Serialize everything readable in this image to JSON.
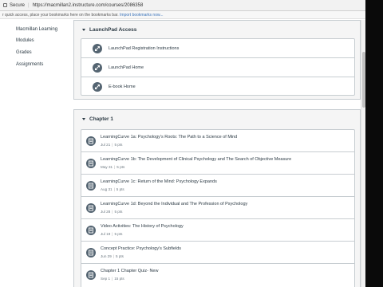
{
  "browser": {
    "secure_label": "Secure",
    "url": "https://macmillan2.instructure.com/courses/2086358",
    "bookmarks_prompt": "r quick access, place your bookmarks here on the bookmarks bar.",
    "import_link": "Import bookmarks now..."
  },
  "nav": {
    "items": [
      {
        "label": "Macmillan Learning"
      },
      {
        "label": "Modules"
      },
      {
        "label": "Grades"
      },
      {
        "label": "Assignments"
      }
    ]
  },
  "modules": [
    {
      "title": "LaunchPad Access",
      "items": [
        {
          "title": "LaunchPad Registration Instructions",
          "icon": "link-icon"
        },
        {
          "title": "LaunchPad Home",
          "icon": "link-icon"
        },
        {
          "title": "E-book Home",
          "icon": "link-icon"
        }
      ]
    },
    {
      "title": "Chapter 1",
      "items": [
        {
          "title": "LearningCurve 1a: Psychology's Roots: The Path to a Science of Mind",
          "date": "Jul 21",
          "points": "5 pts",
          "icon": "assignment-icon"
        },
        {
          "title": "LearningCurve 1b: The Development of Clinical Psychology and The Search of Objective Measure",
          "date": "May 31",
          "points": "5 pts",
          "icon": "assignment-icon"
        },
        {
          "title": "LearningCurve 1c: Return of the Mind: Psychology Expands",
          "date": "Aug 31",
          "points": "5 pts",
          "icon": "assignment-icon"
        },
        {
          "title": "LearningCurve 1d: Beyond the Individual and The Profession of Psychology",
          "date": "Jul 28",
          "points": "5 pts",
          "icon": "assignment-icon"
        },
        {
          "title": "Video Activities: The History of Psychology",
          "date": "Jul 19",
          "points": "5 pts",
          "icon": "assignment-icon"
        },
        {
          "title": "Concept Practice: Psychology's Subfields",
          "date": "Jun 29",
          "points": "5 pts",
          "icon": "assignment-icon"
        },
        {
          "title": "Chapter 1 Chapter Quiz- New",
          "date": "Sep 1",
          "points": "15 pts",
          "icon": "assignment-icon"
        }
      ]
    }
  ]
}
